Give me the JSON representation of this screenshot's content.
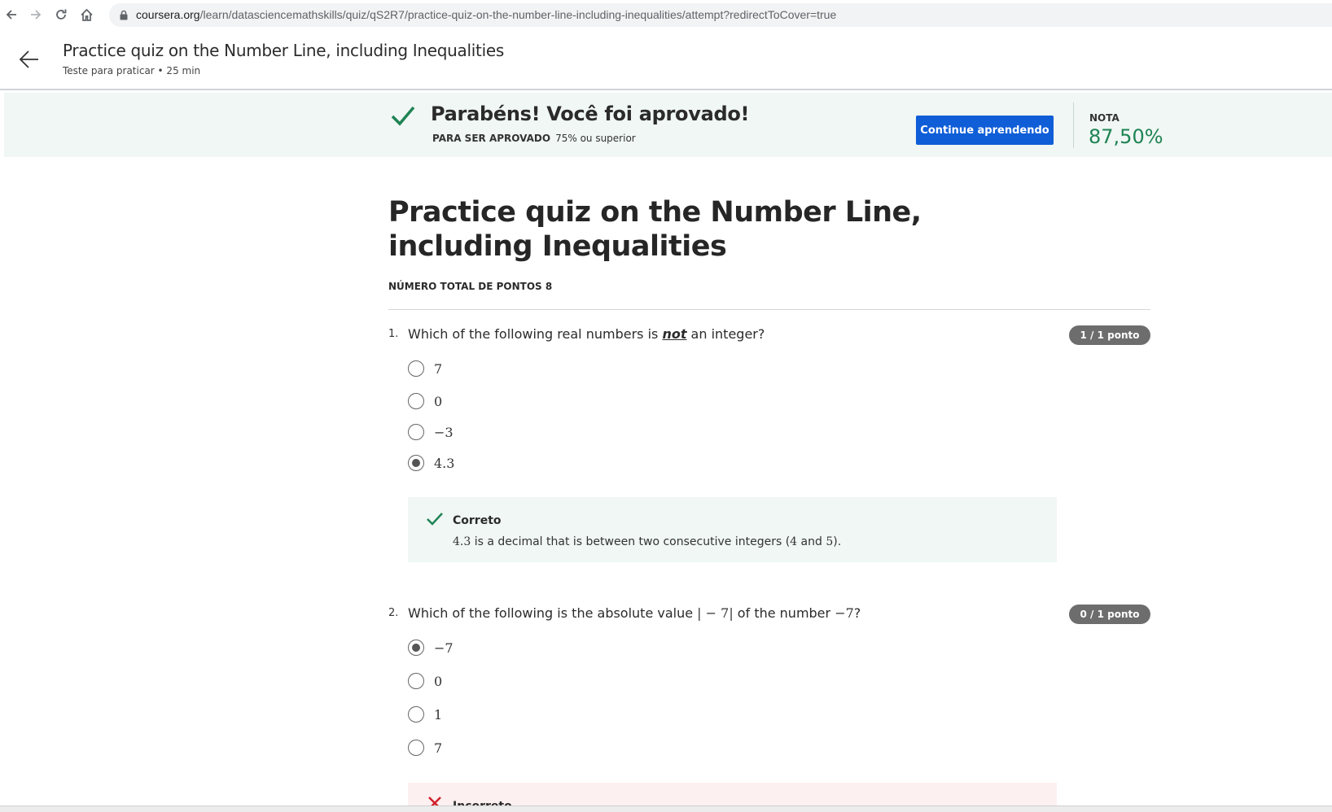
{
  "browser": {
    "url_host": "coursera.org",
    "url_path": "/learn/datasciencemathskills/quiz/qS2R7/practice-quiz-on-the-number-line-including-inequalities/attempt?redirectToCover=true"
  },
  "header": {
    "title": "Practice quiz on the Number Line, including Inequalities",
    "subtitle": "Teste para praticar • 25 min"
  },
  "banner": {
    "title": "Parabéns! Você foi aprovado!",
    "requirement_label": "PARA SER APROVADO",
    "requirement_value": "75% ou superior",
    "button_label": "Continue aprendendo",
    "grade_label": "NOTA",
    "grade_value": "87,50%"
  },
  "quiz": {
    "title": "Practice quiz on the Number Line, including Inequalities",
    "total_points": "NÚMERO TOTAL DE PONTOS 8"
  },
  "questions": [
    {
      "number": "1.",
      "text_before": "Which of the following real numbers is ",
      "text_emphasis": "not",
      "text_after": " an integer?",
      "badge": "1 / 1 ponto",
      "options": [
        "7",
        "0",
        "−3",
        "4.3"
      ],
      "selected_index": 3,
      "feedback_title": "Correto",
      "feedback_m1": "4.3",
      "feedback_t1": " is a decimal that is between two consecutive integers (",
      "feedback_m2": "4",
      "feedback_t2": " and ",
      "feedback_m3": "5",
      "feedback_t3": ")."
    },
    {
      "number": "2.",
      "text_before": "Which of the following is the absolute value ",
      "text_math1": "| − 7|",
      "text_mid": " of the number ",
      "text_math2": "−7",
      "text_after": "?",
      "badge": "0 / 1 ponto",
      "options": [
        "−7",
        "0",
        "1",
        "7"
      ],
      "selected_index": 0,
      "feedback_title": "Incorreto"
    }
  ],
  "colors": {
    "accent_blue": "#0f5ed8",
    "success_green": "#1f8354",
    "banner_bg": "#f0f7f4",
    "error_red": "#d1202a"
  }
}
